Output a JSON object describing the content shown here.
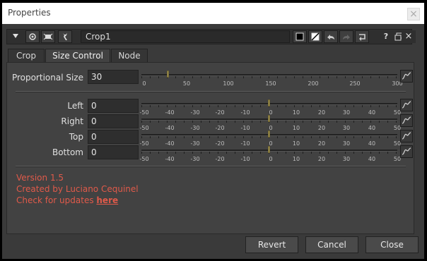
{
  "window": {
    "title": "Properties",
    "close_symbol": "×"
  },
  "toolbar": {
    "node_name": "Crop1",
    "left_icons": [
      "collapse-triangle-icon",
      "view-node-icon",
      "center-node-icon",
      "wrench-icon"
    ],
    "right_icons": [
      "black-swatch-icon",
      "swatch-slash-icon",
      "undo-icon",
      "redo-icon",
      "revert-icon",
      "help-icon",
      "float-panel-icon",
      "close-panel-icon"
    ],
    "help_label": "?",
    "close_label": "×"
  },
  "tabs": [
    {
      "label": "Crop",
      "active": false
    },
    {
      "label": "Size Control",
      "active": true
    },
    {
      "label": "Node",
      "active": false
    }
  ],
  "proportional": {
    "label": "Proportional Size",
    "value": "30",
    "slider_ticks": [
      "0",
      "50",
      "100",
      "150",
      "200",
      "250",
      "300"
    ],
    "slider_min": 0,
    "slider_max": 300
  },
  "params": [
    {
      "label": "Left",
      "value": "0"
    },
    {
      "label": "Right",
      "value": "0"
    },
    {
      "label": "Top",
      "value": "0"
    },
    {
      "label": "Bottom",
      "value": "0"
    }
  ],
  "sym_ticks": [
    "-50",
    "-40",
    "-30",
    "-20",
    "-10",
    "0",
    "10",
    "20",
    "30",
    "40",
    "50"
  ],
  "sym_min": -50,
  "sym_max": 50,
  "info": {
    "version": "Version 1.5",
    "created": "Created by Luciano Cequinel",
    "updates_text": "Check for updates ",
    "updates_link": "here"
  },
  "footer": {
    "revert": "Revert",
    "cancel": "Cancel",
    "close": "Close"
  },
  "colors": {
    "accent_text": "#e05a4a",
    "slider_handle": "#b3a35a",
    "panel_bg": "#424242"
  }
}
